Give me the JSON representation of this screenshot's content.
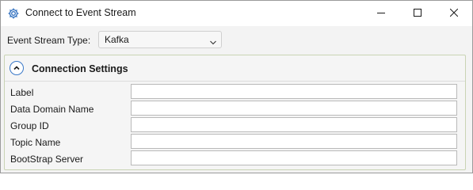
{
  "window": {
    "title": "Connect to Event Stream",
    "icons": {
      "app": "gear-icon",
      "minimize": "minimize-icon",
      "maximize": "maximize-icon",
      "close": "close-icon"
    }
  },
  "event_stream_type": {
    "label": "Event Stream Type:",
    "selected": "Kafka",
    "icon": "chevron-down-icon"
  },
  "connection_settings": {
    "title": "Connection Settings",
    "collapse_icon": "chevron-up-icon",
    "accent_color": "#3a78c8",
    "fields": [
      {
        "label": "Label",
        "value": ""
      },
      {
        "label": "Data Domain Name",
        "value": ""
      },
      {
        "label": "Group ID",
        "value": ""
      },
      {
        "label": "Topic Name",
        "value": ""
      },
      {
        "label": "BootStrap Server",
        "value": ""
      }
    ]
  }
}
